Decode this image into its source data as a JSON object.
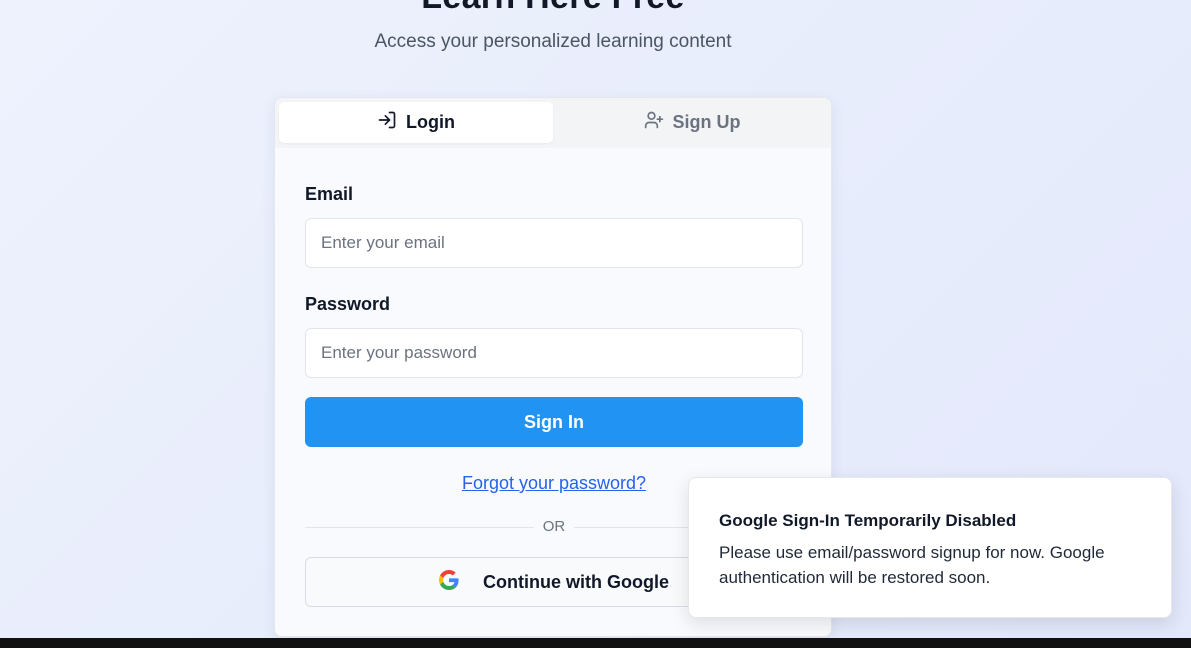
{
  "hero": {
    "title": "Learn Here Free",
    "subtitle": "Access your personalized learning content"
  },
  "tabs": {
    "login": {
      "label": "Login",
      "icon": "login-icon"
    },
    "signup": {
      "label": "Sign Up",
      "icon": "user-plus-icon"
    }
  },
  "form": {
    "email_label": "Email",
    "email_placeholder": "Enter your email",
    "email_value": "",
    "password_label": "Password",
    "password_placeholder": "Enter your password",
    "password_value": "",
    "signin_label": "Sign In",
    "forgot_label": "Forgot your password?",
    "divider_label": "OR",
    "google_label": "Continue with Google",
    "google_icon": "google-icon"
  },
  "toast": {
    "title": "Google Sign-In Temporarily Disabled",
    "message": "Please use email/password signup for now. Google authentication will be restored soon."
  },
  "colors": {
    "primary": "#2193f3",
    "link": "#2563eb",
    "google_blue": "#4285F4",
    "google_red": "#EA4335",
    "google_yellow": "#FBBC05",
    "google_green": "#34A853"
  }
}
